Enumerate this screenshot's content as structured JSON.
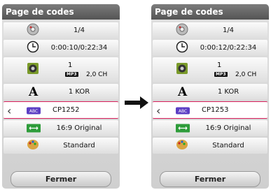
{
  "left": {
    "title": "Page de codes",
    "title_page": "1/4",
    "time": "0:00:10/0:22:34",
    "audio_num": "1",
    "audio_fmt": "MP3",
    "audio_ch": "2,0 CH",
    "subtitle_lang": "1 KOR",
    "code_page": "CP1252",
    "aspect": "16:9 Original",
    "picture_mode": "Standard",
    "close_label": "Fermer"
  },
  "right": {
    "title": "Page de codes",
    "title_page": "1/4",
    "time": "0:00:12/0:22:34",
    "audio_num": "1",
    "audio_fmt": "MP3",
    "audio_ch": "2,0 CH",
    "subtitle_lang": "1 KOR",
    "code_page": "CP1253",
    "aspect": "16:9 Original",
    "picture_mode": "Standard",
    "close_label": "Fermer"
  },
  "icons": [
    "disc-icon",
    "clock-icon",
    "speaker-icon",
    "subtitle-letter-icon",
    "abc-codepage-icon",
    "aspect-ratio-icon",
    "palette-icon",
    "chevron-left-icon",
    "next-arrow-icon"
  ],
  "colors": {
    "highlight": "#d81e5b",
    "title_bar": "#5e5e5e"
  },
  "abc_text": "ABC"
}
